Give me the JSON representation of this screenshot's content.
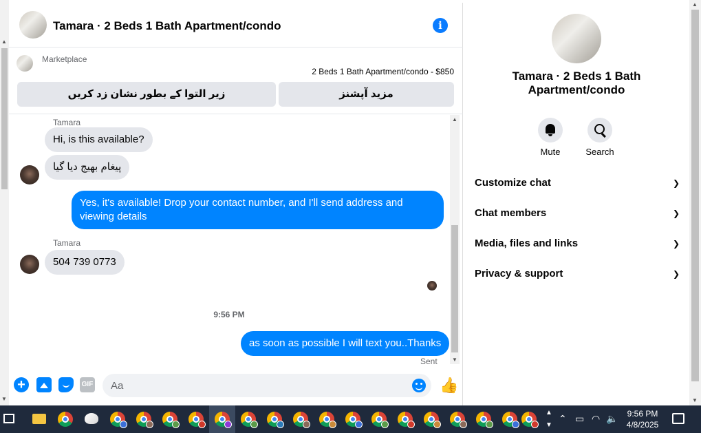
{
  "header": {
    "title": "Tamara · 2 Beds 1 Bath Apartment/condo"
  },
  "marketplace": {
    "label": "Marketplace",
    "listing": "2 Beds 1 Bath Apartment/condo - $850",
    "buttons": [
      "زیر التوا کے بطور نشان زد کریں",
      "مزید آپشنز"
    ]
  },
  "messages": [
    {
      "sender": "Tamara",
      "text": "Hi, is this available?",
      "direction": "in"
    },
    {
      "text": "پیغام بھیج دیا گیا",
      "direction": "in"
    },
    {
      "text": "Yes, it's available! Drop your contact number, and I'll send address and viewing details",
      "direction": "out"
    },
    {
      "sender": "Tamara",
      "text": "504 739 0773",
      "direction": "in"
    },
    {
      "time": "9:56 PM"
    },
    {
      "text": "as soon as possible I will text you..Thanks",
      "direction": "out",
      "status": "Sent"
    }
  ],
  "composer": {
    "placeholder": "Aa",
    "gif_label": "GIF"
  },
  "right_panel": {
    "title": "Tamara · 2 Beds 1 Bath Apartment/condo",
    "actions": [
      {
        "label": "Mute",
        "icon": "bell-icon"
      },
      {
        "label": "Search",
        "icon": "search-icon"
      }
    ],
    "sections": [
      "Customize chat",
      "Chat members",
      "Media, files and links",
      "Privacy & support"
    ]
  },
  "taskbar": {
    "time": "9:56 PM",
    "date": "4/8/2025"
  },
  "colors": {
    "accent": "#0084ff",
    "incoming_bubble": "#e4e6eb",
    "taskbar": "#1f2a3c"
  }
}
